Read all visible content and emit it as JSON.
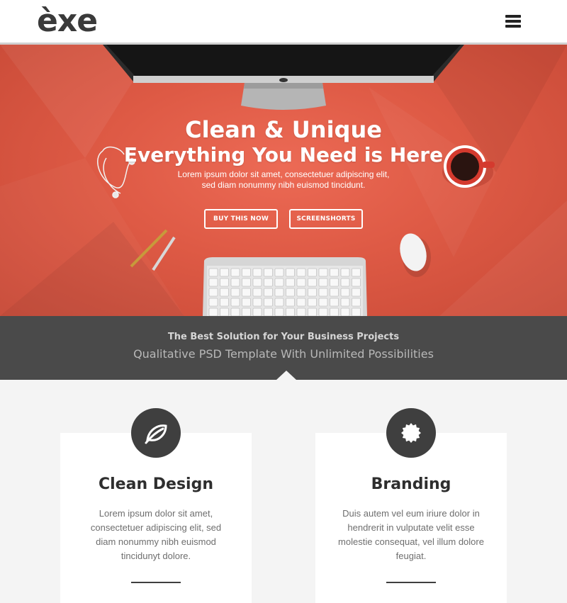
{
  "header": {
    "logo_text": "èxe",
    "menu_icon": "hamburger-menu-icon"
  },
  "hero": {
    "title": "Clean & Unique",
    "subtitle": "Everything You Need is Here",
    "description": "Lorem ipsum dolor sit amet, consectetuer adipiscing elit, sed diam nonummy nibh euismod tincidunt.",
    "buy_label": "BUY THIS NOW",
    "screenshots_label": "SCREENSHORTS",
    "background_color": "#de5a45"
  },
  "banner": {
    "title": "The Best Solution for Your Business Projects",
    "subtitle": "Qualitative PSD Template With Unlimited Possibilities"
  },
  "features": [
    {
      "icon": "leaf-icon",
      "title": "Clean Design",
      "text": "Lorem ipsum dolor sit amet, consectetuer adipiscing elit, sed diam nonummy nibh euismod tincidunyt dolore."
    },
    {
      "icon": "gear-badge-icon",
      "title": "Branding",
      "text": "Duis autem vel eum iriure dolor in hendrerit in vulputate velit esse molestie consequat, vel illum dolore feugiat."
    }
  ]
}
